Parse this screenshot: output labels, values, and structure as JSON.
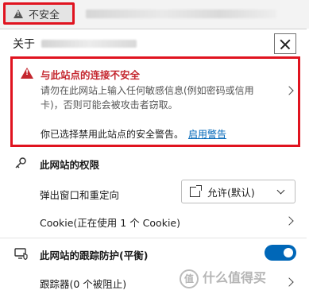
{
  "address_bar": {
    "security_label": "不安全"
  },
  "panel": {
    "about_label": "关于",
    "warning": {
      "title": "与此站点的连接不安全",
      "description": "请勿在此网站上输入任何敏感信息(例如密码或信用卡)，否则可能会被攻击者窃取。",
      "disabled_text": "你已选择禁用此站点的安全警告。",
      "enable_link": "启用警告"
    },
    "permissions": {
      "heading": "此网站的权限",
      "popups_label": "弹出窗口和重定向",
      "popups_value": "允许(默认)",
      "cookie_label": "Cookie(正在使用 1 个 Cookie)"
    },
    "tracking": {
      "heading": "此网站的跟踪防护(平衡)",
      "toggle_on": true,
      "trackers_label": "跟踪器(0 个被阻止)"
    }
  },
  "watermark": {
    "text": "什么值得买",
    "glyph": "值"
  },
  "colors": {
    "alert_red": "#c4262e",
    "highlight_border": "#e0131f",
    "link_blue": "#0067b8",
    "toggle_blue": "#0067b8"
  }
}
